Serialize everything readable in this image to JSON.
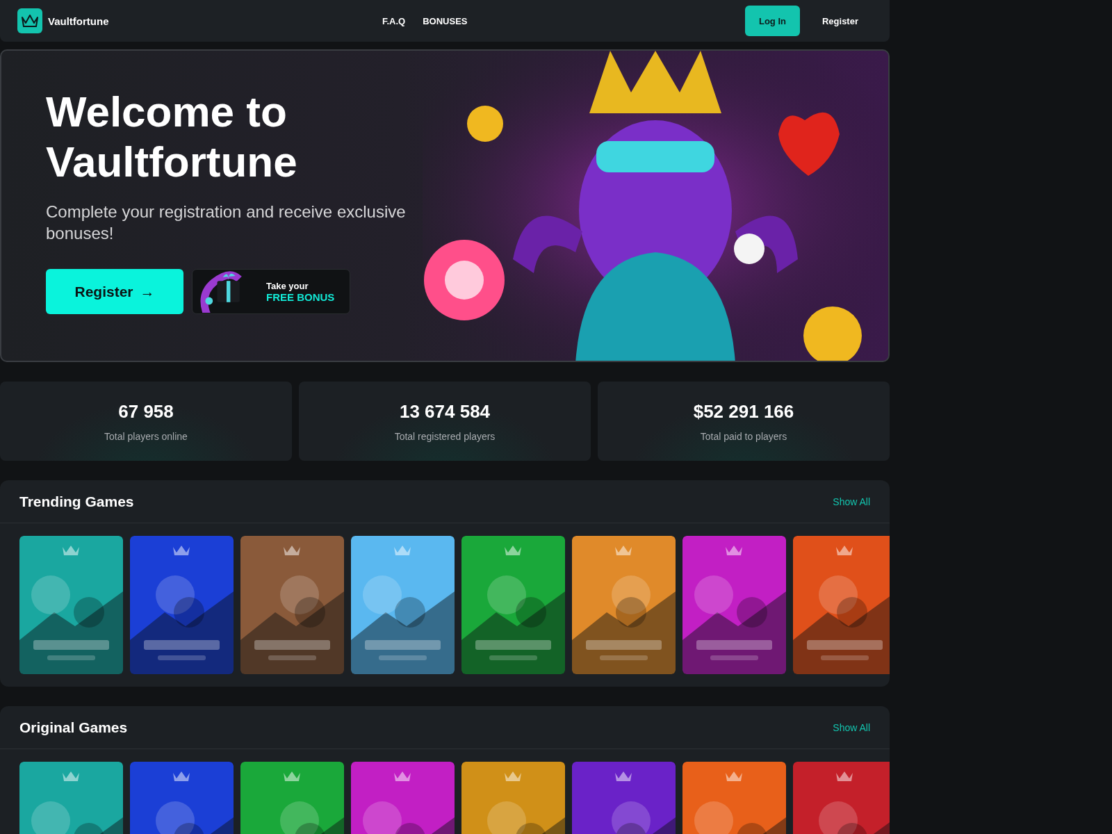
{
  "header": {
    "brand": "Vaultfortune",
    "nav": [
      "F.A.Q",
      "BONUSES"
    ],
    "login": "Log In",
    "register": "Register"
  },
  "hero": {
    "title": "Welcome to Vaultfortune",
    "subtitle": "Complete your registration and receive exclusive bonuses!",
    "cta": "Register",
    "cta_arrow": "→",
    "bonus": {
      "line1": "Take your",
      "line2": "FREE BONUS"
    }
  },
  "stats": [
    {
      "value": "67 958",
      "label": "Total players online"
    },
    {
      "value": "13 674 584",
      "label": "Total registered players"
    },
    {
      "value": "$52 291 166",
      "label": "Total paid to players"
    }
  ],
  "sections": [
    {
      "title": "Trending Games",
      "link": "Show All"
    },
    {
      "title": "Original Games",
      "link": "Show All"
    }
  ]
}
